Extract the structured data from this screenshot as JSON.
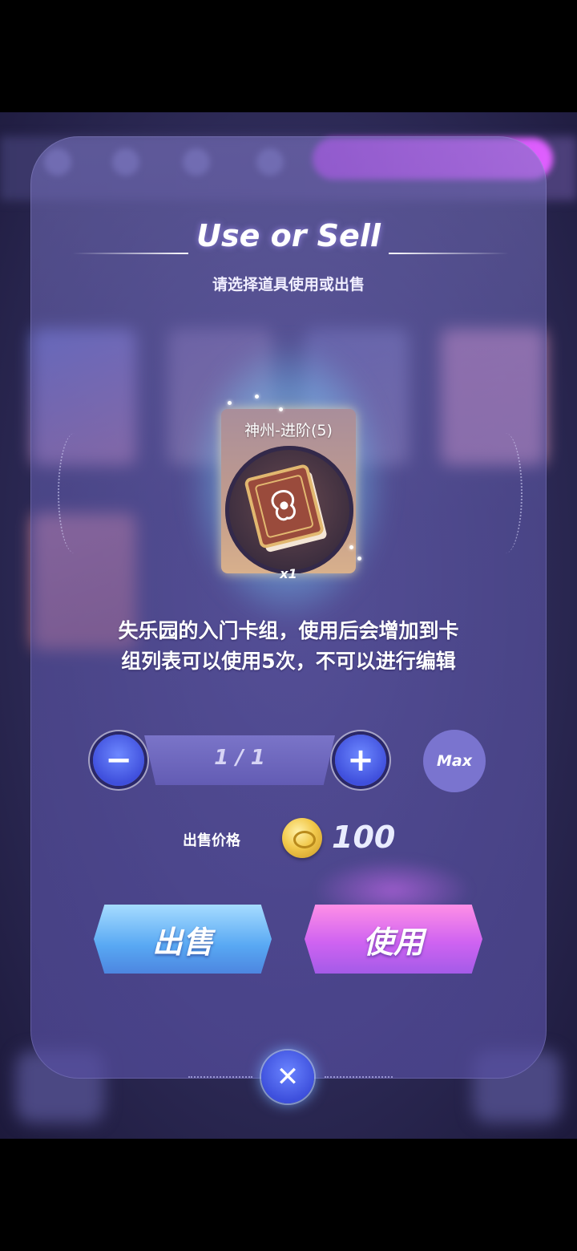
{
  "dialog": {
    "title": "Use or Sell",
    "subtitle": "请选择道具使用或出售"
  },
  "item": {
    "name": "神州-进阶(5)",
    "count": "x1",
    "description_line1": "失乐园的入门卡组，使用后会增加到卡",
    "description_line2": "组列表可以使用5次，不可以进行编辑",
    "icon": "deck-book-icon"
  },
  "quantity": {
    "display": "1 / 1",
    "minus_glyph": "−",
    "plus_glyph": "+",
    "max_label": "Max"
  },
  "price": {
    "label": "出售价格",
    "value": "100",
    "currency_icon": "gold-coin-icon"
  },
  "actions": {
    "sell_label": "出售",
    "use_label": "使用",
    "close_glyph": "✕"
  },
  "colors": {
    "sell_accent": "#58a8f3",
    "use_accent": "#cf63f1",
    "panel": "#5c56a5"
  }
}
